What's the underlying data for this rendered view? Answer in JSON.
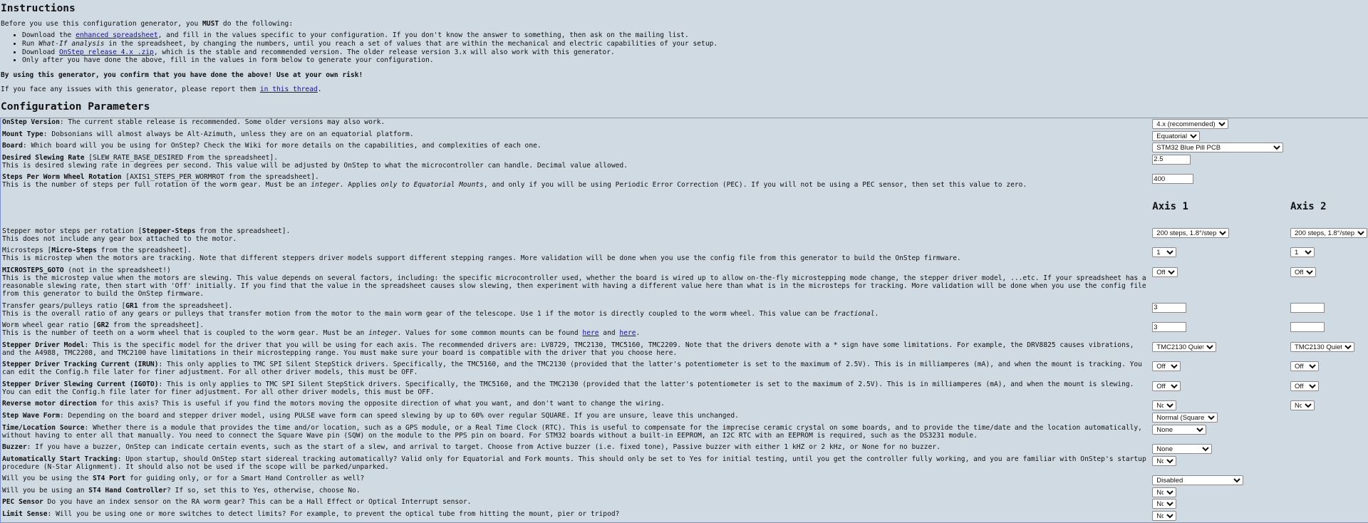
{
  "instructions": {
    "title": "Instructions",
    "intro_pre": "Before you use this configuration generator, you ",
    "intro_must": "MUST",
    "intro_post": " do the following:",
    "items": [
      {
        "pre": "Download the ",
        "link": "enhanced spreadsheet",
        "post": ", and fill in the values specific to your configuration. If you don't know the answer to something, then ask on the mailing list."
      },
      {
        "pre": "Run ",
        "em": "What-If analysis",
        "post": " in the spreadsheet, by changing the numbers, until you reach a set of values that are within the mechanical and electric capabilities of your setup."
      },
      {
        "pre": "Download ",
        "link": "OnStep release 4.x .zip",
        "post": ", which is the stable and recommended version. The older release version 3.x will also work with this generator."
      },
      {
        "text": "Only after you have done the above, fill in the values in form below to generate your configuration."
      }
    ],
    "warning": "By using this generator, you confirm that you have done the above! Use at your own risk!",
    "issues_pre": "If you face any issues with this generator, please report them ",
    "issues_link": "in this thread",
    "issues_post": "."
  },
  "config": {
    "title": "Configuration Parameters",
    "axis1": "Axis 1",
    "axis2": "Axis 2",
    "onstep_version": {
      "label": "OnStep Version",
      "desc": ": The current stable release is recommended. Some older versions may also work.",
      "value": "4.x (recommended)"
    },
    "mount_type": {
      "label": "Mount Type",
      "desc": ": Dobsonians will almost always be Alt-Azimuth, unless they are on an equatorial platform.",
      "value": "Equatorial"
    },
    "board": {
      "label": "Board",
      "desc": ": Which board will you be using for OnStep? Check the Wiki for more details on the capabilities, and complexities of each one.",
      "value": "STM32 Blue Pill PCB"
    },
    "slew_rate": {
      "label": "Desired Slewing Rate",
      "desc1": " [SLEW_RATE_BASE_DESIRED From the spreadsheet].",
      "desc2": "This is desired slewing rate in degrees per second. This value will be adjusted by OnStep to what the microcontroller can handle. Decimal value allowed.",
      "value": "2.5"
    },
    "worm_steps": {
      "label": "Steps Per Worm Wheel Rotation",
      "desc1": " [AXIS1_STEPS_PER_WORMROT from the spreadsheet].",
      "desc2a": "This is the number of steps per full rotation of the worm gear. Must be an ",
      "desc2b": "integer",
      "desc2c": ". Applies ",
      "desc2d": "only to Equatorial Mounts",
      "desc2e": ", and only if you will be using Periodic Error Correction (PEC). If you will not be using a PEC sensor, then set this value to zero.",
      "value": "400"
    },
    "stepper_steps": {
      "pre": "Stepper motor steps per rotation [",
      "bold": "Stepper-Steps",
      "post": " from the spreadsheet].",
      "desc2": "This does not include any gear box attached to the motor.",
      "value1": "200 steps, 1.8°/step",
      "value2": "200 steps, 1.8°/step"
    },
    "microsteps": {
      "pre": "Microsteps [",
      "bold": "Micro-Steps",
      "post": " from the spreadsheet].",
      "desc2": "This is microstep when the motors are tracking. Note that different steppers driver models support different stepping ranges. More validation will be done when you use the config file from this generator to build the OnStep firmware.",
      "value1": "1",
      "value2": "1"
    },
    "microsteps_goto": {
      "label": "MICROSTEPS_GOTO",
      "post": " (not in the spreadsheet!)",
      "desc2": "This is the microstep value when the motors are slewing. This value depends on several factors, including: the specific microcontroller used, whether the board is wired up to allow on-the-fly microstepping mode change, the stepper driver model, ...etc. If your spreadsheet has a reasonable slewing rate, then start with 'Off' initially. If you find that the value in the spreadsheet causes slow slewing, then experiment with having a different value here than what is in the microsteps for tracking. More validation will be done when you use the config file from this generator to build the OnStep firmware.",
      "value1": "Off",
      "value2": "Off"
    },
    "gr1": {
      "pre": "Transfer gears/pulleys ratio [",
      "bold": "GR1",
      "post": " from the spreadsheet].",
      "desc2a": "This is the overall ratio of any gears or pulleys that transfer motion from the motor to the main worm gear of the telescope. Use 1 if the motor is directly coupled to the worm wheel. This value can be ",
      "desc2b": "fractional",
      "desc2c": ".",
      "value1": "3",
      "value2": ""
    },
    "gr2": {
      "pre": "Worm wheel gear ratio [",
      "bold": "GR2",
      "post": " from the spreadsheet].",
      "desc2a": "This is the number of teeth on a worm wheel that is coupled to the worm gear. Must be an ",
      "desc2b": "integer",
      "desc2c": ". Values for some common mounts can be found ",
      "link1": "here",
      "and": " and ",
      "link2": "here",
      "end": ".",
      "value1": "3",
      "value2": ""
    },
    "driver_model": {
      "label": "Stepper Driver Model",
      "desc": ": This is the specific model for the driver that you will be using for each axis. The recommended drivers are: LV8729, TMC2130, TMC5160, TMC2209. Note that the drivers denote with a * sign have some limitations. For example, the DRV8825 causes vibrations, and the A4988, TMC2208, and TMC2100 have limitations in their microstepping range. You must make sure your board is compatible with the driver that you choose here.",
      "value1": "TMC2130 Quiet",
      "value2": "TMC2130 Quiet"
    },
    "irun": {
      "label": "Stepper Driver Tracking Current (IRUN)",
      "desc": ": This only applies to TMC SPI Silent StepStick drivers. Specifically, the TMC5160, and the TMC2130 (provided that the latter's potentiometer is set to the maximum of 2.5V). This is in milliamperes (mA), and when the mount is tracking. You can edit the Config.h file later for finer adjustment. For all other driver models, this must be OFF.",
      "value1": "Off",
      "value2": "Off"
    },
    "igoto": {
      "label": "Stepper Driver Slewing Current (IGOTO)",
      "desc": ": This is only applies to TMC SPI Silent StepStick drivers. Specifically, the TMC5160, and the TMC2130 (provided that the latter's potentiometer is set to the maximum of 2.5V). This is in milliamperes (mA), and when the mount is slewing. You can edit the Config.h file later for finer adjustment. For all other driver models, this must be OFF.",
      "value1": "Off",
      "value2": "Off"
    },
    "reverse": {
      "label": "Reverse motor direction",
      "desc": " for this axis? This is useful if you find the motors moving the opposite direction of what you want, and don't want to change the wiring.",
      "value1": "No",
      "value2": "No"
    },
    "step_wave": {
      "label": "Step Wave Form",
      "desc": ": Depending on the board and stepper driver model, using PULSE wave form can speed slewing by up to 60% over regular SQUARE. If you are unsure, leave this unchanged.",
      "value": "Normal (Square)"
    },
    "time_location": {
      "label": "Time/Location Source",
      "desc": ": Whether there is a module that provides the time and/or location, such as a GPS module, or a Real Time Clock (RTC). This is useful to compensate for the imprecise ceramic crystal on some boards, and to provide the time/date and the location automatically, without having to enter all that manually. You need to connect the Square Wave pin (SQW) on the module to the PPS pin on board. For STM32 boards without a built-in EEPROM, an I2C RTC with an EEPROM is required, such as the DS3231 module.",
      "value": "None"
    },
    "buzzer": {
      "label": "Buzzer",
      "desc": ": If you have a buzzer, OnStep can indicate certain events, such as the start of a slew, and arrival to target. Choose from Active buzzer (i.e. fixed tone), Passive buzzer with either 1 kHZ or 2 kHz, or None for no buzzer.",
      "value": "None"
    },
    "auto_track": {
      "label": "Automatically Start Tracking",
      "desc": ": Upon startup, should OnStep start sidereal tracking automatically? Valid only for Equatorial and Fork mounts. This should only be set to Yes for initial testing, until you get the controller fully working, and you are familiar with OnStep's startup procedure (N-Star Alignment). It should also not be used if the scope will be parked/unparked.",
      "value": "No"
    },
    "st4_port": {
      "pre": "Will you be using the ",
      "bold": "ST4 Port",
      "post": " for guiding only, or for a Smart Hand Controller as well?",
      "value": "Disabled"
    },
    "st4_hand": {
      "pre": "Will you be using an ",
      "bold": "ST4 Hand Controller",
      "post": "? If so, set this to Yes, otherwise, choose No.",
      "value": "No"
    },
    "pec_sensor": {
      "label": "PEC Sensor",
      "desc": " Do you have an index sensor on the RA worm gear? This can be a Hall Effect or Optical Interrupt sensor.",
      "value": "No"
    },
    "limit_sense": {
      "label": "Limit Sense",
      "desc": ": Will you be using one or more switches to detect limits? For example, to prevent the optical tube from hitting the mount, pier or tripod?",
      "value": "No"
    }
  }
}
